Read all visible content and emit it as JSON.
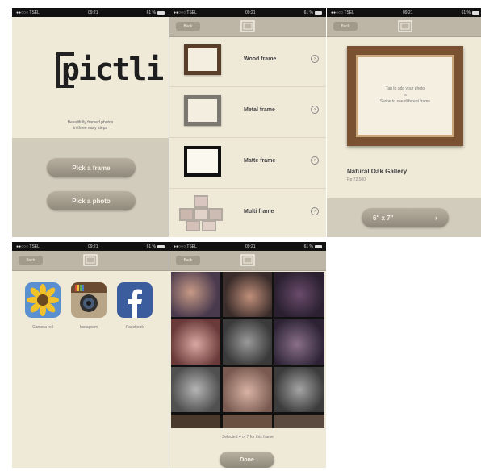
{
  "status": {
    "carrier": "●●○○○ TSEL",
    "time": "09:21",
    "battery": "61 %"
  },
  "nav": {
    "back_label": "Back"
  },
  "home": {
    "logo_text": "pictli",
    "tagline_1": "Beautifully framed photos",
    "tagline_2": "in three easy steps",
    "pick_frame_label": "Pick a frame",
    "pick_photo_label": "Pick a photo"
  },
  "frames": {
    "items": [
      {
        "label": "Wood frame"
      },
      {
        "label": "Metal frame"
      },
      {
        "label": "Matte frame"
      },
      {
        "label": "Multi frame"
      }
    ]
  },
  "detail": {
    "hint_1": "Tap to add your photo",
    "hint_2": "or",
    "hint_3": "Swipe to see different frame",
    "name": "Natural Oak Gallery",
    "price": "Rp 72.500",
    "size_label": "6\" x 7\""
  },
  "sources": {
    "items": [
      {
        "label": "Camera roll",
        "icon": "sunflower-icon"
      },
      {
        "label": "Instagram",
        "icon": "instagram-icon"
      },
      {
        "label": "Facebook",
        "icon": "facebook-icon"
      }
    ]
  },
  "gallery": {
    "status_text": "Selected 4 of 7 for this frame",
    "done_label": "Done"
  },
  "colors": {
    "background": "#efe9d8",
    "navbar": "#bdb6a6",
    "pill": "#9e9889",
    "wood": "#7a5232"
  }
}
